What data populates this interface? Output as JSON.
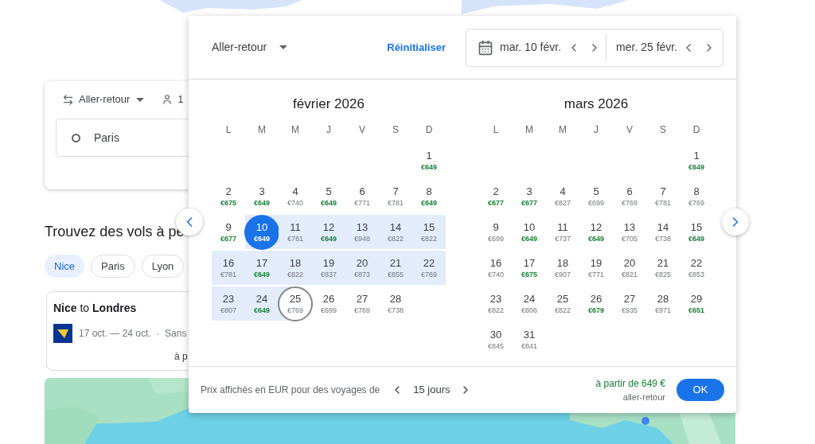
{
  "search_card": {
    "trip_type": "Aller-retour",
    "passengers": "1",
    "origin": "Paris"
  },
  "section_title": "Trouvez des vols à pe",
  "chips": [
    {
      "label": "Nice",
      "selected": true
    },
    {
      "label": "Paris",
      "selected": false
    },
    {
      "label": "Lyon",
      "selected": false
    }
  ],
  "flight_card": {
    "title": "**Nice** to **Londres**",
    "dates": "17 oct. — 24 oct.  ·  Sans",
    "price": "à p"
  },
  "picker": {
    "trip_type": "Aller-retour",
    "reset": "Réinitialiser",
    "depart": "mar. 10 févr.",
    "return": "mer. 25 févr.",
    "months": [
      {
        "title": "février 2026",
        "weekdays": [
          "L",
          "M",
          "M",
          "J",
          "V",
          "S",
          "D"
        ],
        "weeks": [
          [
            {
              "day": "1",
              "price": "€649",
              "cheap": true,
              "kind": "plain"
            }
          ],
          [
            {
              "day": "2",
              "price": "€675",
              "cheap": true,
              "kind": "plain"
            },
            {
              "day": "3",
              "price": "€649",
              "cheap": true,
              "kind": "plain"
            },
            {
              "day": "4",
              "price": "€740",
              "cheap": false,
              "kind": "plain"
            },
            {
              "day": "5",
              "price": "€649",
              "cheap": true,
              "kind": "plain"
            },
            {
              "day": "6",
              "price": "€771",
              "cheap": false,
              "kind": "plain"
            },
            {
              "day": "7",
              "price": "€781",
              "cheap": false,
              "kind": "plain"
            },
            {
              "day": "8",
              "price": "€649",
              "cheap": true,
              "kind": "plain"
            }
          ],
          [
            {
              "day": "9",
              "price": "€677",
              "cheap": true,
              "kind": "plain"
            },
            {
              "day": "10",
              "price": "€649",
              "cheap": true,
              "kind": "start"
            },
            {
              "day": "11",
              "price": "€781",
              "cheap": false,
              "kind": "range"
            },
            {
              "day": "12",
              "price": "€649",
              "cheap": true,
              "kind": "range"
            },
            {
              "day": "13",
              "price": "€948",
              "cheap": false,
              "kind": "range"
            },
            {
              "day": "14",
              "price": "€822",
              "cheap": false,
              "kind": "range"
            },
            {
              "day": "15",
              "price": "€822",
              "cheap": false,
              "kind": "range"
            }
          ],
          [
            {
              "day": "16",
              "price": "€781",
              "cheap": false,
              "kind": "range"
            },
            {
              "day": "17",
              "price": "€649",
              "cheap": true,
              "kind": "range"
            },
            {
              "day": "18",
              "price": "€822",
              "cheap": false,
              "kind": "range"
            },
            {
              "day": "19",
              "price": "€837",
              "cheap": false,
              "kind": "range"
            },
            {
              "day": "20",
              "price": "€873",
              "cheap": false,
              "kind": "range"
            },
            {
              "day": "21",
              "price": "€855",
              "cheap": false,
              "kind": "range"
            },
            {
              "day": "22",
              "price": "€769",
              "cheap": false,
              "kind": "range"
            }
          ],
          [
            {
              "day": "23",
              "price": "€807",
              "cheap": false,
              "kind": "range"
            },
            {
              "day": "24",
              "price": "€649",
              "cheap": true,
              "kind": "range"
            },
            {
              "day": "25",
              "price": "€769",
              "cheap": false,
              "kind": "end"
            },
            {
              "day": "26",
              "price": "€699",
              "cheap": false,
              "kind": "plain"
            },
            {
              "day": "27",
              "price": "€769",
              "cheap": false,
              "kind": "plain"
            },
            {
              "day": "28",
              "price": "€738",
              "cheap": false,
              "kind": "plain"
            }
          ]
        ]
      },
      {
        "title": "mars 2026",
        "weekdays": [
          "L",
          "M",
          "M",
          "J",
          "V",
          "S",
          "D"
        ],
        "weeks": [
          [
            {
              "day": "1",
              "price": "€649",
              "cheap": true,
              "kind": "plain"
            }
          ],
          [
            {
              "day": "2",
              "price": "€677",
              "cheap": true,
              "kind": "plain"
            },
            {
              "day": "3",
              "price": "€677",
              "cheap": true,
              "kind": "plain"
            },
            {
              "day": "4",
              "price": "€827",
              "cheap": false,
              "kind": "plain"
            },
            {
              "day": "5",
              "price": "€699",
              "cheap": false,
              "kind": "plain"
            },
            {
              "day": "6",
              "price": "€769",
              "cheap": false,
              "kind": "plain"
            },
            {
              "day": "7",
              "price": "€781",
              "cheap": false,
              "kind": "plain"
            },
            {
              "day": "8",
              "price": "€769",
              "cheap": false,
              "kind": "plain"
            }
          ],
          [
            {
              "day": "9",
              "price": "€699",
              "cheap": false,
              "kind": "plain"
            },
            {
              "day": "10",
              "price": "€649",
              "cheap": true,
              "kind": "plain"
            },
            {
              "day": "11",
              "price": "€737",
              "cheap": false,
              "kind": "plain"
            },
            {
              "day": "12",
              "price": "€649",
              "cheap": true,
              "kind": "plain"
            },
            {
              "day": "13",
              "price": "€705",
              "cheap": false,
              "kind": "plain"
            },
            {
              "day": "14",
              "price": "€738",
              "cheap": false,
              "kind": "plain"
            },
            {
              "day": "15",
              "price": "€649",
              "cheap": true,
              "kind": "plain"
            }
          ],
          [
            {
              "day": "16",
              "price": "€740",
              "cheap": false,
              "kind": "plain"
            },
            {
              "day": "17",
              "price": "€675",
              "cheap": true,
              "kind": "plain"
            },
            {
              "day": "18",
              "price": "€907",
              "cheap": false,
              "kind": "plain"
            },
            {
              "day": "19",
              "price": "€771",
              "cheap": false,
              "kind": "plain"
            },
            {
              "day": "20",
              "price": "€821",
              "cheap": false,
              "kind": "plain"
            },
            {
              "day": "21",
              "price": "€825",
              "cheap": false,
              "kind": "plain"
            },
            {
              "day": "22",
              "price": "€853",
              "cheap": false,
              "kind": "plain"
            }
          ],
          [
            {
              "day": "23",
              "price": "€822",
              "cheap": false,
              "kind": "plain"
            },
            {
              "day": "24",
              "price": "€806",
              "cheap": false,
              "kind": "plain"
            },
            {
              "day": "25",
              "price": "€822",
              "cheap": false,
              "kind": "plain"
            },
            {
              "day": "26",
              "price": "€679",
              "cheap": true,
              "kind": "plain"
            },
            {
              "day": "27",
              "price": "€935",
              "cheap": false,
              "kind": "plain"
            },
            {
              "day": "28",
              "price": "€971",
              "cheap": false,
              "kind": "plain"
            },
            {
              "day": "29",
              "price": "€651",
              "cheap": true,
              "kind": "plain"
            }
          ],
          [
            {
              "day": "30",
              "price": "€845",
              "cheap": false,
              "kind": "plain"
            },
            {
              "day": "31",
              "price": "€841",
              "cheap": false,
              "kind": "plain"
            }
          ]
        ]
      }
    ],
    "footer": {
      "note": "Prix affichés en EUR pour des voyages de",
      "duration": "15 jours",
      "from_price": "à partir de 649 €",
      "trip_label": "aller-retour",
      "ok": "OK"
    }
  }
}
